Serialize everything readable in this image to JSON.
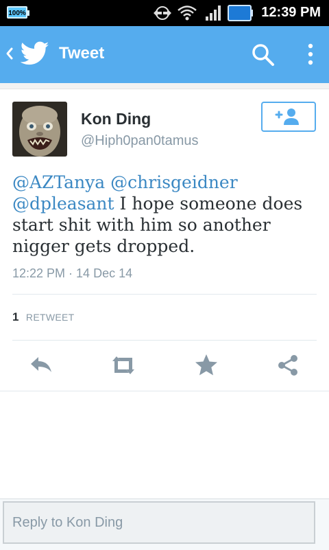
{
  "status_bar": {
    "battery_label": "100%",
    "time": "12:39 PM"
  },
  "action_bar": {
    "title": "Tweet",
    "icons": [
      "back-chevron-icon",
      "twitter-bird-icon",
      "search-icon",
      "overflow-menu-icon"
    ]
  },
  "tweet": {
    "author_name": "Kon Ding",
    "author_handle": "@Hiph0pan0tamus",
    "mentions": [
      "@AZTanya",
      "@chrisgeidner",
      "@dpleasant"
    ],
    "body_text": "I hope someone does start shit with him so another nigger gets dropped.",
    "timestamp": "12:22 PM · 14 Dec 14",
    "retweet_count": "1",
    "retweet_label": "RETWEET",
    "actions": [
      "reply-icon",
      "retweet-icon",
      "favorite-icon",
      "share-icon"
    ]
  },
  "reply": {
    "placeholder": "Reply to Kon Ding"
  },
  "colors": {
    "brand_blue": "#55acee",
    "mention_blue": "#3b88c3",
    "muted_gray": "#8899a6",
    "text_dark": "#292f33"
  }
}
